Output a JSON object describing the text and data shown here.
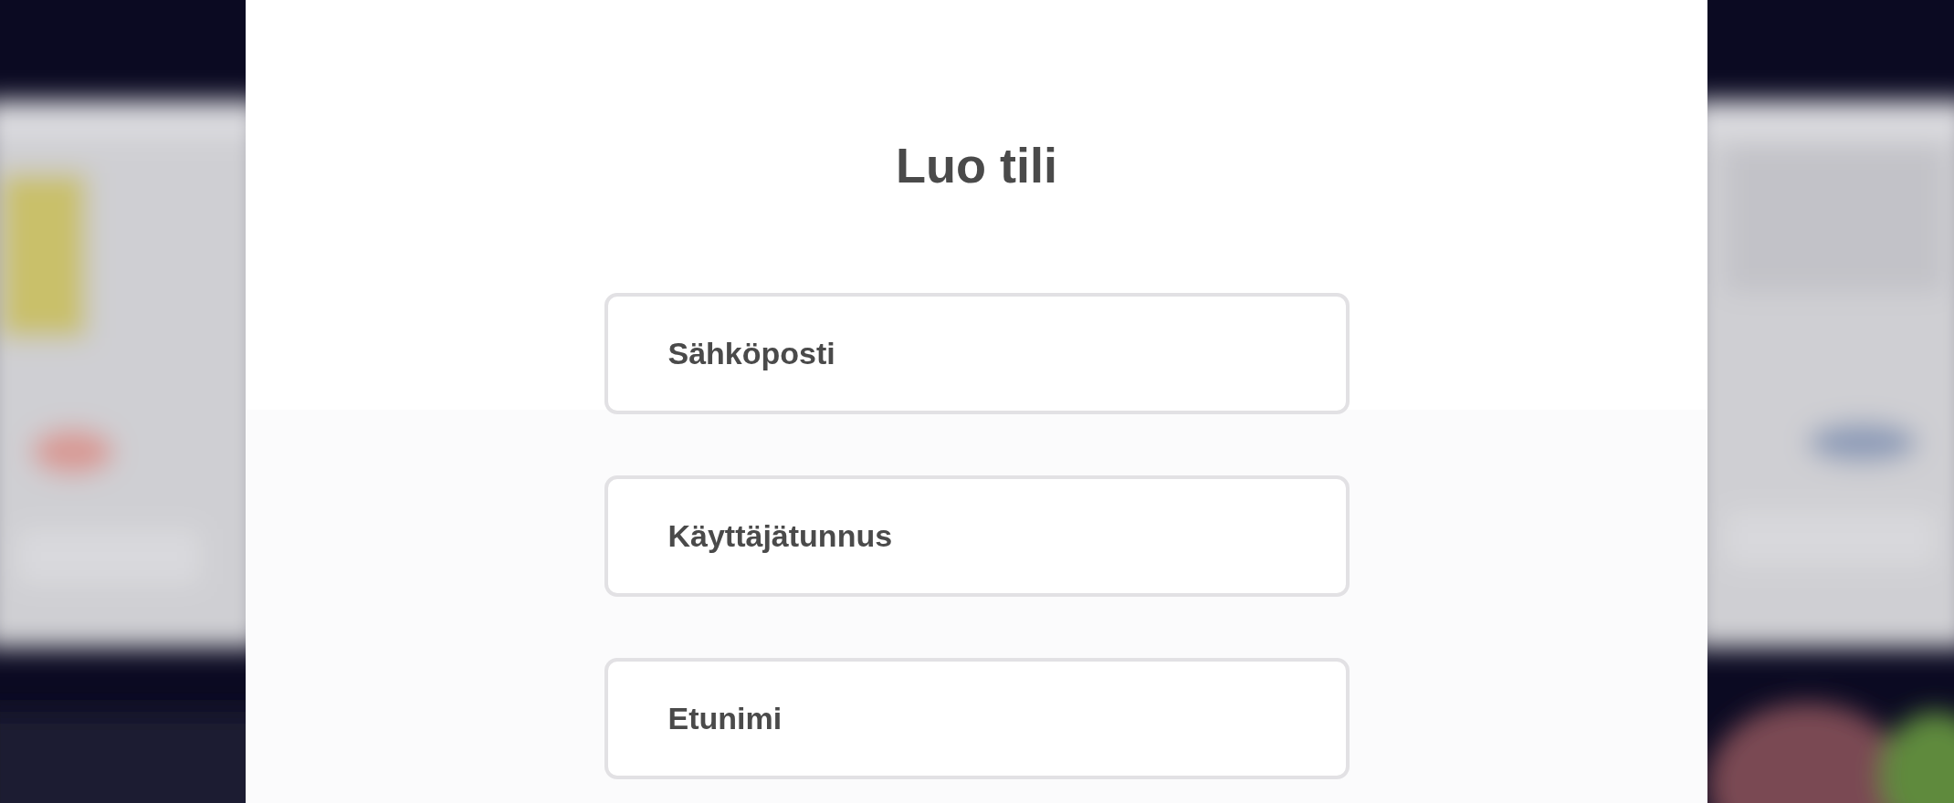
{
  "dialog": {
    "title": "Luo tili",
    "fields": [
      {
        "placeholder": "Sähköposti"
      },
      {
        "placeholder": "Käyttäjätunnus"
      },
      {
        "placeholder": "Etunimi"
      }
    ]
  }
}
